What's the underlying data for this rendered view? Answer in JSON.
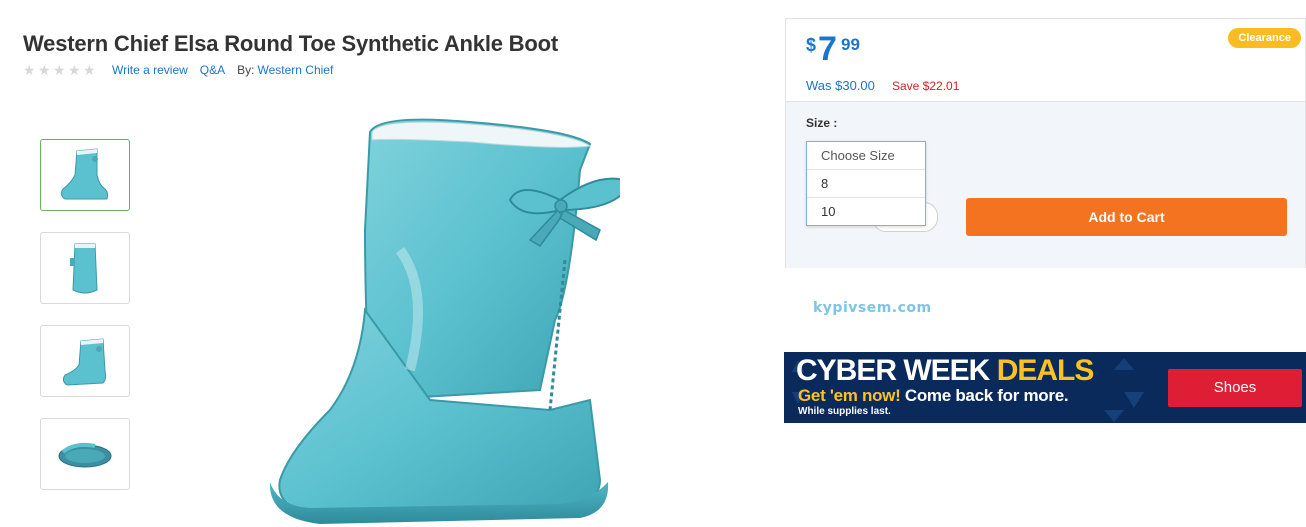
{
  "product": {
    "title": "Western Chief Elsa Round Toe Synthetic Ankle Boot",
    "write_review": "Write a review",
    "qa": "Q&A",
    "by_label": "By:",
    "brand": "Western Chief",
    "rating_stars": 0,
    "rating_max": 5
  },
  "thumbnails": [
    {
      "view": "side",
      "selected": true
    },
    {
      "view": "back",
      "selected": false
    },
    {
      "view": "three-quarter",
      "selected": false
    },
    {
      "view": "sole",
      "selected": false
    }
  ],
  "buy_box": {
    "price_symbol": "$",
    "price_whole": "7",
    "price_cents": "99",
    "was_price": "Was $30.00",
    "save_text": "Save $22.01",
    "badge": "Clearance",
    "size_label": "Size :",
    "size_options": [
      "Choose Size",
      "8",
      "10"
    ],
    "add_to_cart": "Add to Cart"
  },
  "watermark": "kypivsem.com",
  "banner": {
    "headline_1": "CYBER WEEK ",
    "headline_2": "DEALS",
    "sub_1": "Get 'em now!",
    "sub_2": " Come back for more.",
    "small": "While supplies last.",
    "button": "Shoes"
  },
  "colors": {
    "link": "#1a75cf",
    "price": "#1a75cf",
    "save": "#de1c24",
    "add_to_cart": "#f47321",
    "badge": "#fbbc22",
    "banner_bg": "#0a2a5c",
    "banner_accent": "#ffc220",
    "banner_button": "#dd1e35",
    "boot": "#5cc1cf"
  }
}
